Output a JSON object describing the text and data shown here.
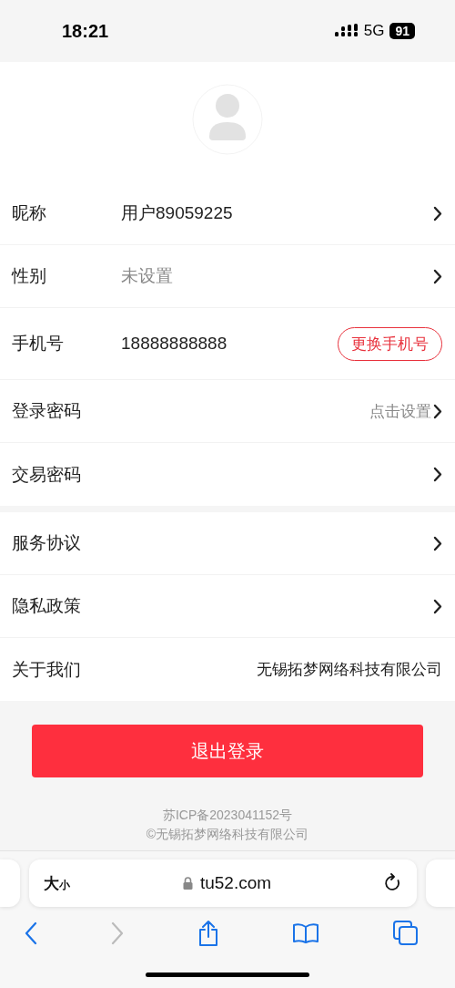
{
  "status_bar": {
    "time": "18:21",
    "network": "5G",
    "battery": "91"
  },
  "groups": [
    {
      "rows": [
        {
          "label": "昵称",
          "kind": "value",
          "value": "用户89059225"
        },
        {
          "label": "性别",
          "kind": "muted",
          "value": "未设置"
        },
        {
          "label": "手机号",
          "kind": "action",
          "value": "18888888888",
          "action": "更换手机号"
        },
        {
          "label": "登录密码",
          "kind": "hint",
          "value": "点击设置"
        },
        {
          "label": "交易密码",
          "kind": "nav"
        }
      ]
    },
    {
      "rows": [
        {
          "label": "服务协议",
          "kind": "nav"
        },
        {
          "label": "隐私政策",
          "kind": "nav"
        },
        {
          "label": "关于我们",
          "kind": "info",
          "value": "无锡拓梦网络科技有限公司"
        }
      ]
    }
  ],
  "logout_button": "退出登录",
  "footer": [
    "苏ICP备2023041152号",
    "©无锡拓梦网络科技有限公司"
  ],
  "browser": {
    "text_size": "大",
    "text_size_small": "小",
    "url": "tu52.com"
  }
}
